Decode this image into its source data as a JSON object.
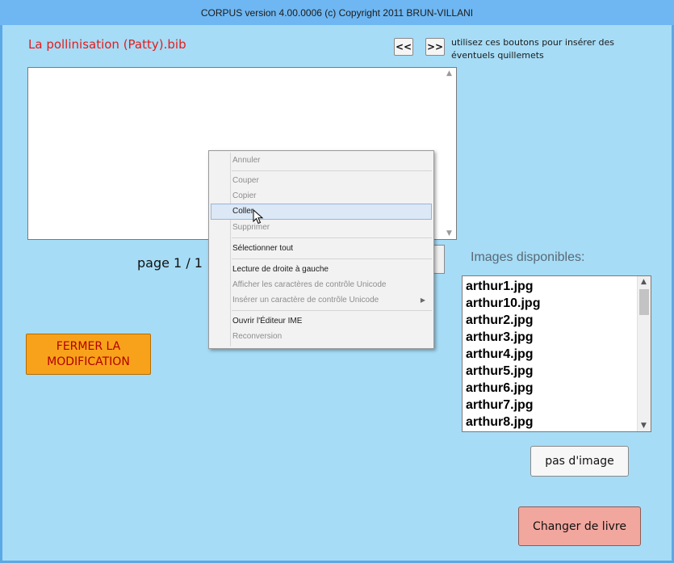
{
  "window": {
    "title": "CORPUS version 4.00.0006 (c) Copyright 2011 BRUN-VILLANI"
  },
  "document": {
    "name": "La pollinisation (Patty).bib",
    "page_indicator": "page 1 / 1"
  },
  "quote_buttons": {
    "left_label": "<<",
    "right_label": ">>",
    "hint": "utilisez ces boutons pour insérer des éventuels quillemets"
  },
  "context_menu": {
    "items": [
      {
        "label": "Annuler",
        "enabled": false
      },
      {
        "label": "Couper",
        "enabled": false
      },
      {
        "label": "Copier",
        "enabled": false
      },
      {
        "label": "Coller",
        "enabled": true,
        "highlighted": true
      },
      {
        "label": "Supprimer",
        "enabled": false
      },
      {
        "label": "Sélectionner tout",
        "enabled": true
      },
      {
        "label": "Lecture de droite à gauche",
        "enabled": true
      },
      {
        "label": "Afficher les caractères de contrôle Unicode",
        "enabled": false
      },
      {
        "label": "Insérer un caractère de contrôle Unicode",
        "enabled": false,
        "submenu": true
      },
      {
        "label": "Ouvrir l'Éditeur IME",
        "enabled": true
      },
      {
        "label": "Reconversion",
        "enabled": false
      }
    ]
  },
  "fermer_button": {
    "line1": "FERMER LA",
    "line2": "MODIFICATION"
  },
  "images": {
    "label": "Images disponibles:",
    "files": [
      "arthur1.jpg",
      "arthur10.jpg",
      "arthur2.jpg",
      "arthur3.jpg",
      "arthur4.jpg",
      "arthur5.jpg",
      "arthur6.jpg",
      "arthur7.jpg",
      "arthur8.jpg"
    ]
  },
  "buttons": {
    "no_image": "pas d'image",
    "change_book": "Changer de livre"
  },
  "colors": {
    "background": "#a6dcf6",
    "title_bar": "#6fb7f2",
    "doc_title": "#e31c1c",
    "fermer_bg": "#f8a21b",
    "fermer_text": "#b10000",
    "changer_bg": "#f2a79e"
  }
}
